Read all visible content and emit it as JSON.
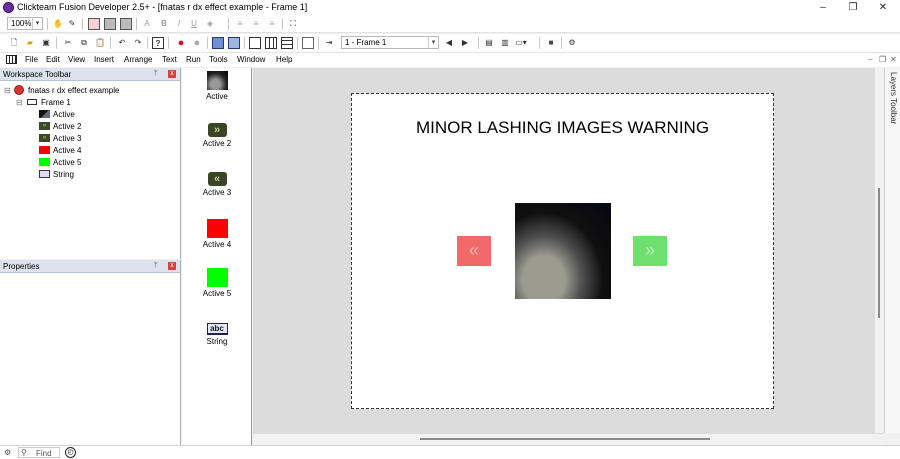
{
  "app": {
    "title": "Clickteam Fusion Developer 2.5+ - [fnatas r dx effect example - Frame 1]"
  },
  "window_controls": {
    "minimize": "–",
    "maximize": "❐",
    "close": "✕"
  },
  "toolbar1": {
    "zoom": "100%"
  },
  "toolbar2": {
    "frame_select": "1 - Frame 1"
  },
  "menu": [
    "File",
    "Edit",
    "View",
    "Insert",
    "Arrange",
    "Text",
    "Run",
    "Tools",
    "Window",
    "Help"
  ],
  "workspace": {
    "title": "Workspace Toolbar",
    "pin": "ᛘ",
    "close": "x",
    "app_node": "fnatas r dx effect example",
    "frame_node": "Frame 1",
    "objects": [
      "Active",
      "Active 2",
      "Active 3",
      "Active 4",
      "Active 5",
      "String"
    ]
  },
  "properties": {
    "title": "Properties",
    "pin": "ᛘ",
    "close": "x"
  },
  "object_bar": {
    "items": [
      {
        "label": "Active",
        "icon": "image-thumbnail-icon"
      },
      {
        "label": "Active 2",
        "icon": "double-arrow-right-icon"
      },
      {
        "label": "Active 3",
        "icon": "double-arrow-left-icon"
      },
      {
        "label": "Active 4",
        "icon": "red-square-icon"
      },
      {
        "label": "Active 5",
        "icon": "green-square-icon"
      },
      {
        "label": "String",
        "icon": "abc-text-icon"
      }
    ]
  },
  "frame_editor": {
    "warning_text": "MINOR LASHING IMAGES WARNING"
  },
  "layers_tab": "Layers Toolbar",
  "status": {
    "find": "Find"
  },
  "colors": {
    "red_button": "#f08080",
    "green_button": "#7de07d",
    "active4": "#ff0000",
    "active5": "#00ff00"
  }
}
